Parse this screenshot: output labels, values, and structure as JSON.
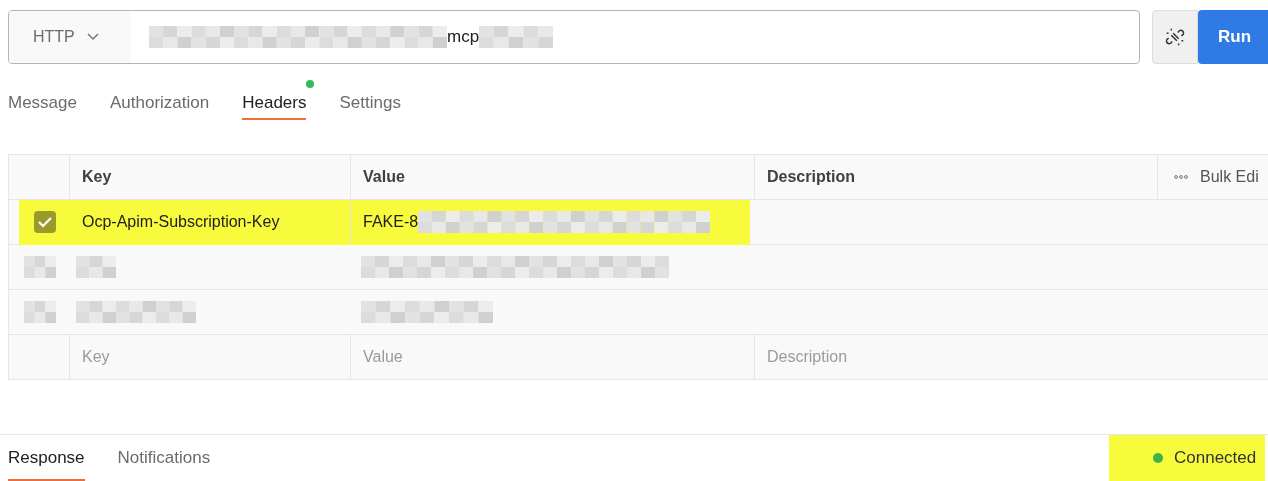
{
  "request": {
    "method": "HTTP",
    "url_visible": "mcp",
    "run_label": "Run"
  },
  "tabs": [
    {
      "label": "Message",
      "selected": false,
      "dot": false
    },
    {
      "label": "Authorization",
      "selected": false,
      "dot": false
    },
    {
      "label": "Headers",
      "selected": true,
      "dot": true
    },
    {
      "label": "Settings",
      "selected": false,
      "dot": false
    }
  ],
  "table": {
    "columns": [
      "Key",
      "Value",
      "Description"
    ],
    "bulk_edit": "Bulk Edi",
    "rows": [
      {
        "kind": "entry",
        "checked": true,
        "highlighted": true,
        "key": "Ocp-Apim-Subscription-Key",
        "value": "FAKE-8"
      },
      {
        "kind": "redacted"
      },
      {
        "kind": "redacted"
      }
    ],
    "placeholders": {
      "key": "Key",
      "value": "Value",
      "description": "Description"
    }
  },
  "bottom_tabs": [
    {
      "label": "Response",
      "selected": true
    },
    {
      "label": "Notifications",
      "selected": false
    }
  ],
  "status": {
    "label": "Connected",
    "color": "#3cb44b",
    "highlighted": true
  }
}
